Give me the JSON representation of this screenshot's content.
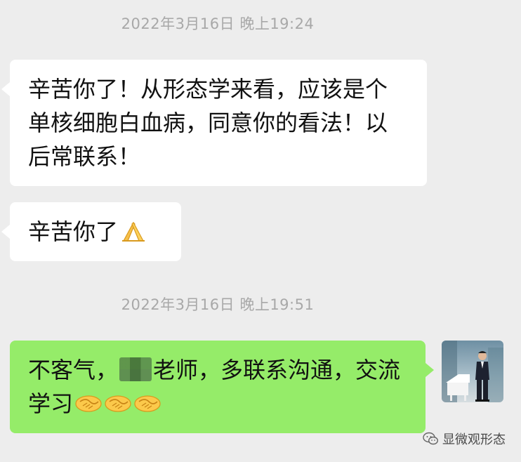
{
  "timestamps": [
    "2022年3月16日 晚上19:24",
    "2022年3月16日 晚上19:51"
  ],
  "messages": {
    "m1": {
      "text": "辛苦你了！从形态学来看，应该是个单核细胞白血病，同意你的看法！以后常联系！"
    },
    "m2": {
      "text": "辛苦你了",
      "emoji": "folded-hands-emoji"
    },
    "m3": {
      "text_before": "不客气，",
      "redacted": "blurred-name",
      "text_after": "老师，多联系沟通，交流学习",
      "emojis": [
        "handshake-emoji",
        "handshake-emoji",
        "handshake-emoji"
      ]
    }
  },
  "watermark": {
    "text": "显微观形态",
    "icon": "wechat-icon"
  },
  "colors": {
    "background": "#ededed",
    "incoming_bubble": "#ffffff",
    "outgoing_bubble": "#95ec69",
    "timestamp_text": "#a8a8a8"
  }
}
